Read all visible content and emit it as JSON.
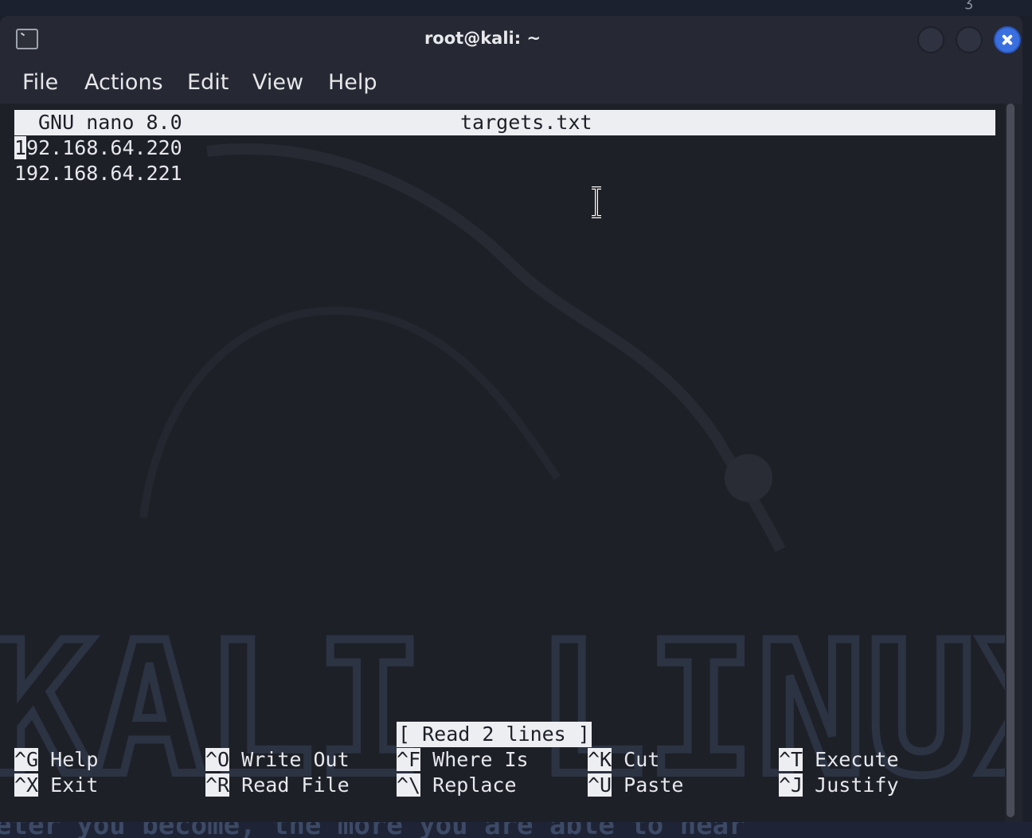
{
  "window": {
    "title": "root@kali: ~",
    "icon": "terminal-icon",
    "controls": [
      "minimize",
      "maximize",
      "close"
    ],
    "accent_color": "#3a6fe0"
  },
  "menubar": {
    "items": [
      "File",
      "Actions",
      "Edit",
      "View",
      "Help"
    ]
  },
  "nano": {
    "version": "GNU nano 8.0",
    "filename": "targets.txt",
    "lines": [
      "192.168.64.220",
      "192.168.64.221"
    ],
    "cursor_char": "1",
    "first_line_rest": "92.168.64.220",
    "status": "[ Read 2 lines ]",
    "shortcuts": [
      {
        "key": "^G",
        "label": "Help"
      },
      {
        "key": "^O",
        "label": "Write Out"
      },
      {
        "key": "^F",
        "label": "Where Is"
      },
      {
        "key": "^K",
        "label": "Cut"
      },
      {
        "key": "^T",
        "label": "Execute"
      },
      {
        "key": "^X",
        "label": "Exit"
      },
      {
        "key": "^R",
        "label": "Read File"
      },
      {
        "key": "^\\",
        "label": "Replace"
      },
      {
        "key": "^U",
        "label": "Paste"
      },
      {
        "key": "^J",
        "label": "Justify"
      }
    ]
  },
  "desktop": {
    "watermark": "KALI LINUX",
    "quote_fragment": "eter you become, the more you are able to hear\""
  }
}
